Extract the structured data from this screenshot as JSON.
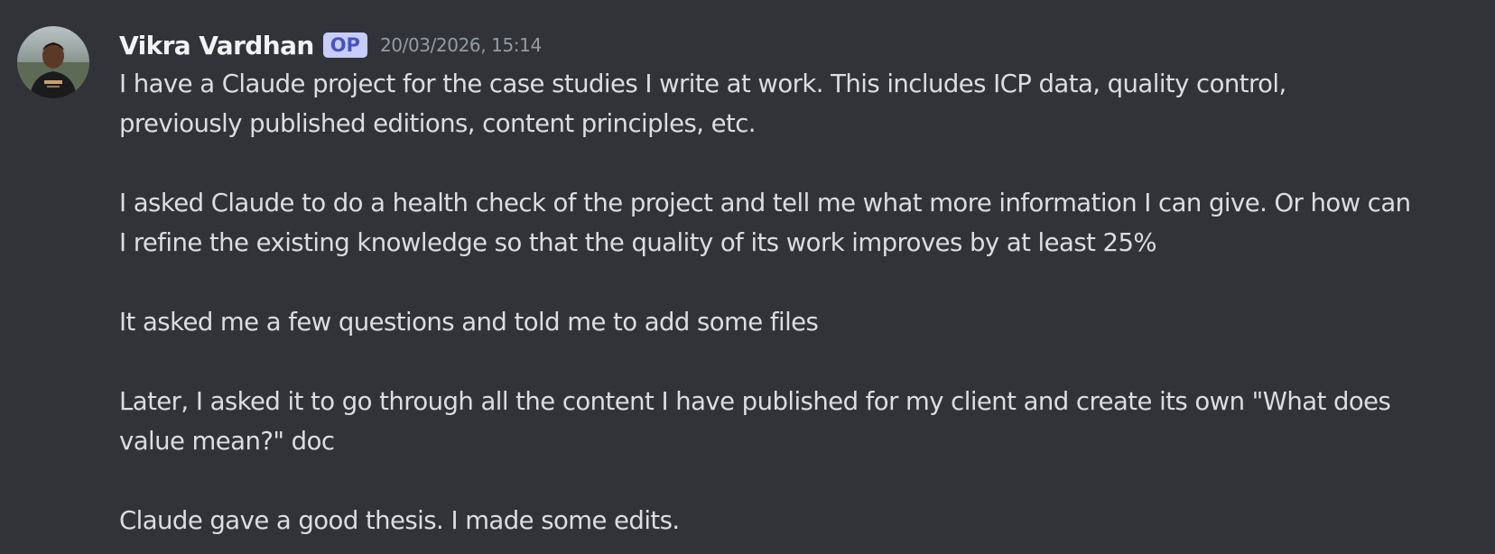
{
  "message": {
    "author": "Vikra Vardhan",
    "badge": "OP",
    "timestamp": "20/03/2026, 15:14",
    "paragraphs": [
      "I have a Claude project for the case studies I write at work. This includes ICP data, quality control,\npreviously published editions, content principles, etc.",
      "I asked Claude to do a health check of the project and tell me what more information I can give. Or how can\nI refine the existing knowledge so that the quality of its work improves by at least 25%",
      "It asked me a few questions and told me to add some files",
      "Later, I asked it to go through all the content I have published for my client and create its own \"What does\nvalue mean?\" doc",
      "Claude gave a good thesis. I made some edits."
    ]
  },
  "colors": {
    "background": "#323339",
    "author": "#f2f3f5",
    "text": "#dbdee1",
    "timestamp": "#949ba4",
    "badge_bg": "#c9cdfb",
    "badge_text": "#4752c4"
  },
  "icons": {
    "avatar": "user-avatar-photo"
  }
}
